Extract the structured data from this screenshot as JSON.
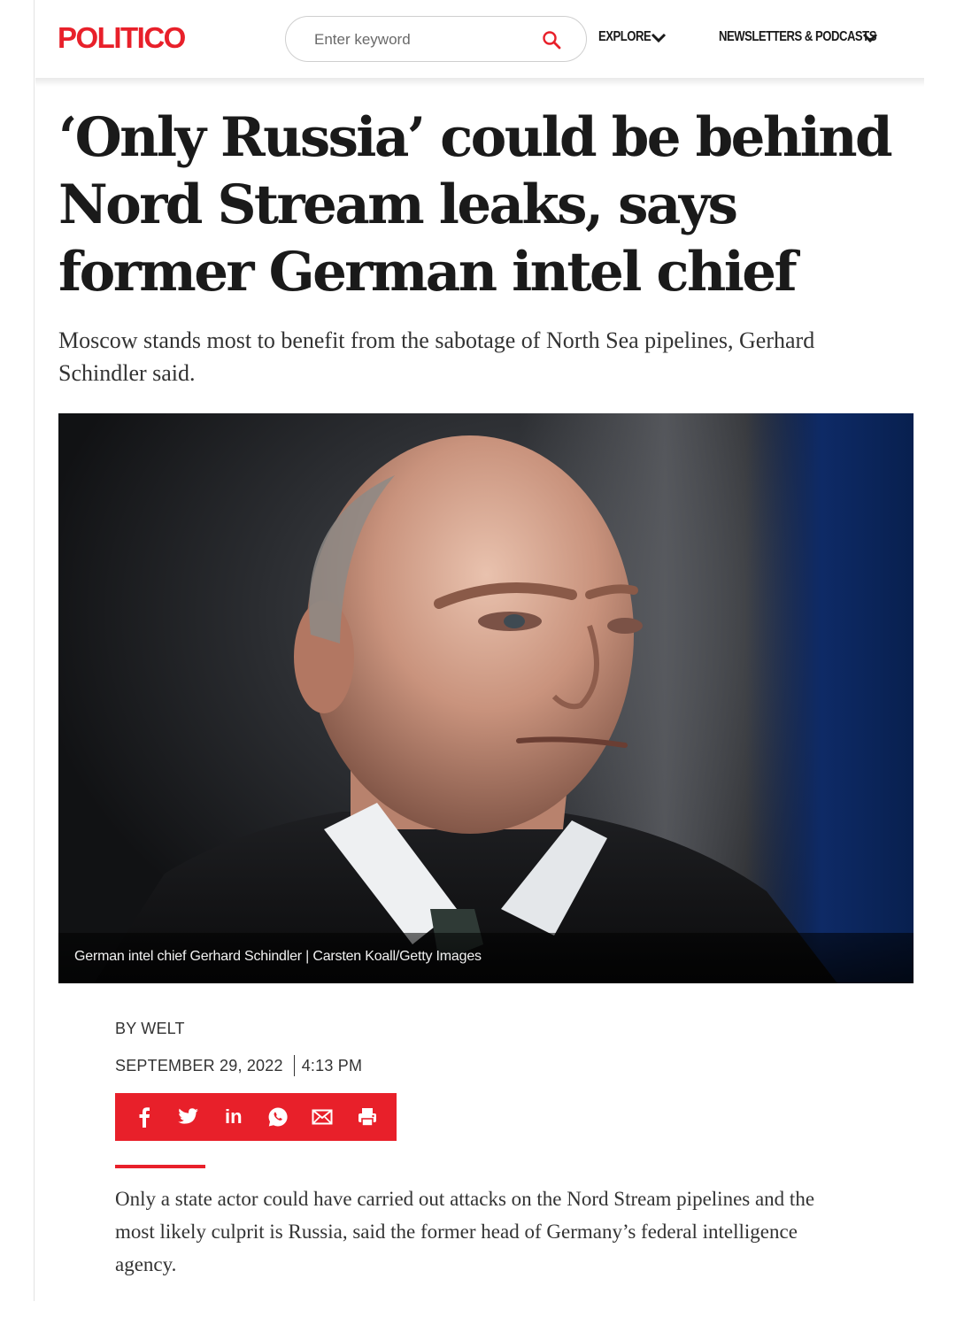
{
  "header": {
    "logo": "POLITICO",
    "search_placeholder": "Enter keyword",
    "nav": [
      {
        "label": "EXPLORE"
      },
      {
        "label": "NEWSLETTERS & PODCASTS"
      }
    ]
  },
  "article": {
    "headline": "‘Only Russia’ could be behind Nord Stream leaks, says former German intel chief",
    "subheadline": "Moscow stands most to benefit from the sabotage of North Sea pipelines, Gerhard Schindler said.",
    "photo_caption": "German intel chief Gerhard Schindler | Carsten Koall/Getty Images",
    "byline": "BY WELT",
    "date": "SEPTEMBER 29, 2022",
    "time": "4:13 PM",
    "share_icons": [
      "facebook-icon",
      "twitter-icon",
      "linkedin-icon",
      "whatsapp-icon",
      "email-icon",
      "print-icon"
    ],
    "share_linkedin_text": "in",
    "body_first_paragraph": "Only a state actor could have carried out attacks on the Nord Stream pipelines and the most likely culprit is Russia, said the former head of Germany’s federal intelligence agency."
  },
  "colors": {
    "brand_red": "#e8202a",
    "text": "#1a1a1a"
  }
}
